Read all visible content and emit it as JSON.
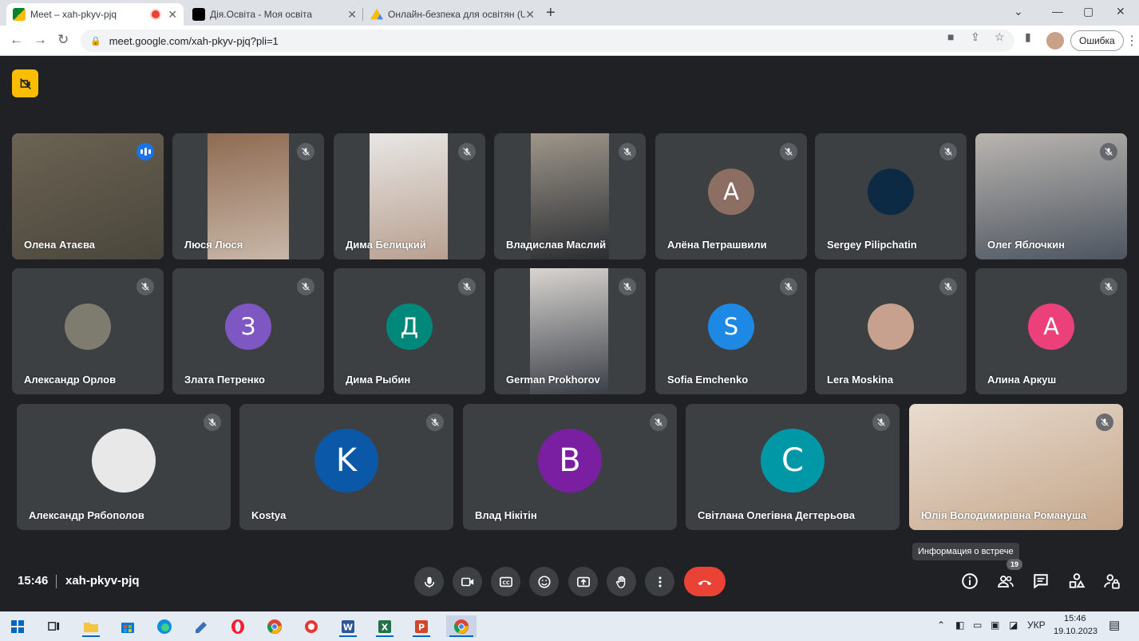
{
  "browser": {
    "tabs": [
      {
        "title": "Meet – xah-pkyv-pjq",
        "active": true,
        "recording": true
      },
      {
        "title": "Дія.Освіта - Моя освіта",
        "active": false
      },
      {
        "title": "Онлайн-безпека для освітян (U",
        "active": false
      }
    ],
    "url": "meet.google.com/xah-pkyv-pjq?pli=1",
    "error_button": "Ошибка",
    "window_controls": [
      "chevron-down-icon",
      "minimize-icon",
      "maximize-icon",
      "close-icon"
    ]
  },
  "meet": {
    "participants": [
      {
        "name": "Олена Атаєва",
        "type": "video",
        "speaking": true
      },
      {
        "name": "Люся Люся",
        "type": "video"
      },
      {
        "name": "Дима Белицкий",
        "type": "video"
      },
      {
        "name": "Владислав Маслий",
        "type": "video"
      },
      {
        "name": "Алёна Петрашвили",
        "type": "letter",
        "letter": "А",
        "color": "#8d6e63"
      },
      {
        "name": "Sergey Pilipchatin",
        "type": "photo",
        "color": "#0d2a45"
      },
      {
        "name": "Олег Яблочкин",
        "type": "video"
      },
      {
        "name": "Александр Орлов",
        "type": "photo",
        "color": "#7d7c6f"
      },
      {
        "name": "Злата Петренко",
        "type": "letter",
        "letter": "З",
        "color": "#7e57c2"
      },
      {
        "name": "Дима Рыбин",
        "type": "letter",
        "letter": "Д",
        "color": "#00897b"
      },
      {
        "name": "German Prokhorov",
        "type": "video"
      },
      {
        "name": "Sofia Emchenko",
        "type": "letter",
        "letter": "S",
        "color": "#1e88e5"
      },
      {
        "name": "Lera Moskina",
        "type": "photo",
        "color": "#c7a08e"
      },
      {
        "name": "Алина Аркуш",
        "type": "letter",
        "letter": "А",
        "color": "#ec407a"
      },
      {
        "name": "Александр Рябополов",
        "type": "photo",
        "color": "#e8e8e8"
      },
      {
        "name": "Kostya",
        "type": "letter",
        "letter": "K",
        "color": "#0b57a8"
      },
      {
        "name": "Влад Нікітін",
        "type": "letter",
        "letter": "В",
        "color": "#7b1fa2"
      },
      {
        "name": "Світлана Олегівна Дегтерьова",
        "type": "letter",
        "letter": "С",
        "color": "#0097a7"
      },
      {
        "name": "Юлія Володимирівна Романуша",
        "type": "video"
      }
    ],
    "bottom_bar": {
      "time": "15:46",
      "meeting_code": "xah-pkyv-pjq",
      "info_tooltip": "Информация о встрече",
      "participant_count": "19"
    }
  },
  "taskbar": {
    "language": "УКР",
    "time": "15:46",
    "date": "19.10.2023"
  }
}
